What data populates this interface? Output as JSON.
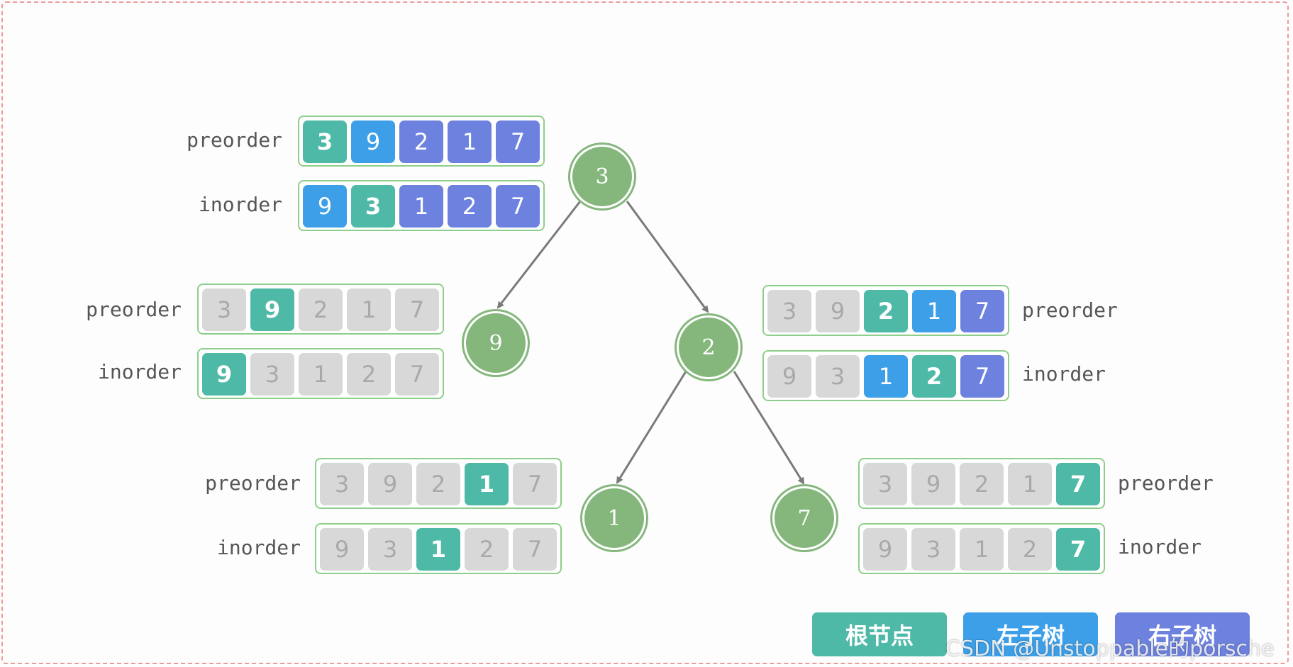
{
  "tree": {
    "nodes": [
      {
        "id": "n3",
        "value": "3"
      },
      {
        "id": "n9",
        "value": "9"
      },
      {
        "id": "n2",
        "value": "2"
      },
      {
        "id": "n1",
        "value": "1"
      },
      {
        "id": "n7",
        "value": "7"
      }
    ],
    "edges": [
      [
        "n3",
        "n9"
      ],
      [
        "n3",
        "n2"
      ],
      [
        "n2",
        "n1"
      ],
      [
        "n2",
        "n7"
      ]
    ]
  },
  "labels": {
    "preorder": "preorder",
    "inorder": "inorder"
  },
  "groups": [
    {
      "id": "g_root",
      "preorder": [
        {
          "v": "3",
          "t": "root"
        },
        {
          "v": "9",
          "t": "left"
        },
        {
          "v": "2",
          "t": "right"
        },
        {
          "v": "1",
          "t": "right"
        },
        {
          "v": "7",
          "t": "right"
        }
      ],
      "inorder": [
        {
          "v": "9",
          "t": "left"
        },
        {
          "v": "3",
          "t": "root"
        },
        {
          "v": "1",
          "t": "right"
        },
        {
          "v": "2",
          "t": "right"
        },
        {
          "v": "7",
          "t": "right"
        }
      ]
    },
    {
      "id": "g_9",
      "preorder": [
        {
          "v": "3",
          "t": "none"
        },
        {
          "v": "9",
          "t": "root"
        },
        {
          "v": "2",
          "t": "none"
        },
        {
          "v": "1",
          "t": "none"
        },
        {
          "v": "7",
          "t": "none"
        }
      ],
      "inorder": [
        {
          "v": "9",
          "t": "root"
        },
        {
          "v": "3",
          "t": "none"
        },
        {
          "v": "1",
          "t": "none"
        },
        {
          "v": "2",
          "t": "none"
        },
        {
          "v": "7",
          "t": "none"
        }
      ]
    },
    {
      "id": "g_2",
      "preorder": [
        {
          "v": "3",
          "t": "none"
        },
        {
          "v": "9",
          "t": "none"
        },
        {
          "v": "2",
          "t": "root"
        },
        {
          "v": "1",
          "t": "left"
        },
        {
          "v": "7",
          "t": "right"
        }
      ],
      "inorder": [
        {
          "v": "9",
          "t": "none"
        },
        {
          "v": "3",
          "t": "none"
        },
        {
          "v": "1",
          "t": "left"
        },
        {
          "v": "2",
          "t": "root"
        },
        {
          "v": "7",
          "t": "right"
        }
      ]
    },
    {
      "id": "g_1",
      "preorder": [
        {
          "v": "3",
          "t": "none"
        },
        {
          "v": "9",
          "t": "none"
        },
        {
          "v": "2",
          "t": "none"
        },
        {
          "v": "1",
          "t": "root"
        },
        {
          "v": "7",
          "t": "none"
        }
      ],
      "inorder": [
        {
          "v": "9",
          "t": "none"
        },
        {
          "v": "3",
          "t": "none"
        },
        {
          "v": "1",
          "t": "root"
        },
        {
          "v": "2",
          "t": "none"
        },
        {
          "v": "7",
          "t": "none"
        }
      ]
    },
    {
      "id": "g_7",
      "preorder": [
        {
          "v": "3",
          "t": "none"
        },
        {
          "v": "9",
          "t": "none"
        },
        {
          "v": "2",
          "t": "none"
        },
        {
          "v": "1",
          "t": "none"
        },
        {
          "v": "7",
          "t": "root"
        }
      ],
      "inorder": [
        {
          "v": "9",
          "t": "none"
        },
        {
          "v": "3",
          "t": "none"
        },
        {
          "v": "1",
          "t": "none"
        },
        {
          "v": "2",
          "t": "none"
        },
        {
          "v": "7",
          "t": "root"
        }
      ]
    }
  ],
  "legend": [
    {
      "key": "root",
      "label": "根节点",
      "color": "#4fb9a8"
    },
    {
      "key": "left",
      "label": "左子树",
      "color": "#3d9fe8"
    },
    {
      "key": "right",
      "label": "右子树",
      "color": "#6c82de"
    }
  ],
  "colors": {
    "none": "#d8d8d8",
    "node": "#85b77d",
    "border": "#8dcf8a",
    "edge": "#7a7a7a"
  },
  "watermark": "CSDN @Unstoppable的porsche"
}
